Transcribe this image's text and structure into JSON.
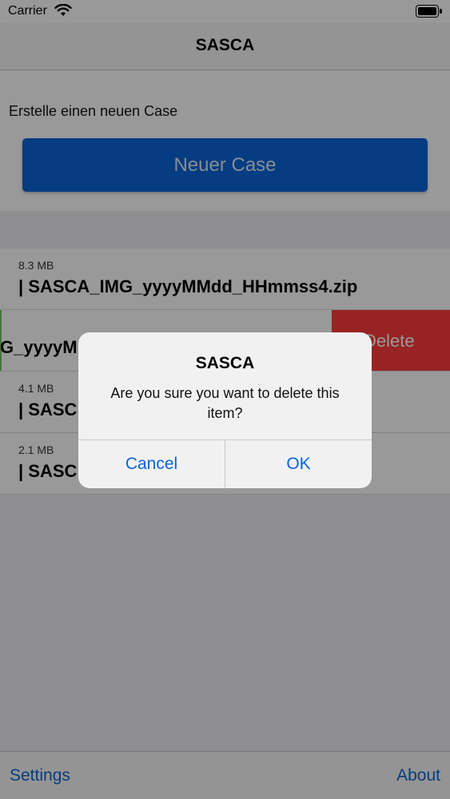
{
  "status_bar": {
    "carrier": "Carrier"
  },
  "nav": {
    "title": "SASCA"
  },
  "header": {
    "prompt": "Erstelle einen neuen Case",
    "new_case_button": "Neuer Case"
  },
  "files": [
    {
      "size": "8.3 MB",
      "name": "| SASCA_IMG_yyyyMMdd_HHmmss4.zip"
    },
    {
      "size": "",
      "name": "G_yyyyM",
      "swiped": true,
      "action": "Delete"
    },
    {
      "size": "4.1 MB",
      "name": "| SASC"
    },
    {
      "size": "2.1 MB",
      "name": "| SASC"
    }
  ],
  "toolbar": {
    "settings": "Settings",
    "about": "About"
  },
  "alert": {
    "title": "SASCA",
    "message": "Are you sure you want to delete this item?",
    "cancel": "Cancel",
    "ok": "OK"
  },
  "colors": {
    "accent": "#0a64d8",
    "delete": "#fc3d39"
  },
  "icons": [
    "wifi-icon",
    "battery-icon"
  ]
}
